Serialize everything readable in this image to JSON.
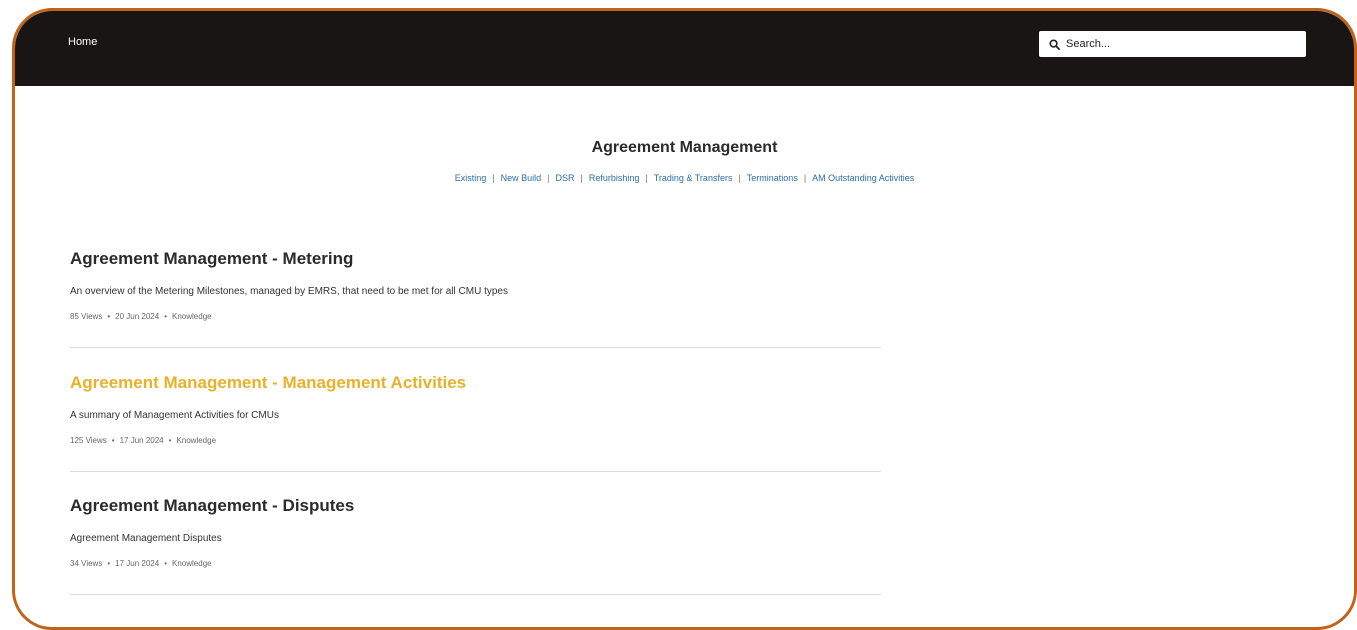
{
  "nav": {
    "home_label": "Home"
  },
  "search": {
    "placeholder": "Search..."
  },
  "page": {
    "title": "Agreement Management",
    "subnav": [
      "Existing",
      "New Build",
      "DSR",
      "Refurbishing",
      "Trading & Transfers",
      "Terminations",
      "AM Outstanding Activities"
    ],
    "subnav_separator": "|"
  },
  "articles": [
    {
      "title": "Agreement Management - Metering",
      "description": "An overview of the Metering Milestones, managed by EMRS, that need to be met for all CMU types",
      "views": "85 Views",
      "date": "20 Jun 2024",
      "type": "Knowledge",
      "highlighted": false
    },
    {
      "title": "Agreement Management - Management Activities",
      "description": "A summary of Management Activities for CMUs",
      "views": "125 Views",
      "date": "17 Jun 2024",
      "type": "Knowledge",
      "highlighted": true
    },
    {
      "title": "Agreement Management - Disputes",
      "description": "Agreement Management Disputes",
      "views": "34 Views",
      "date": "17 Jun 2024",
      "type": "Knowledge",
      "highlighted": false
    }
  ],
  "meta_separator": "•",
  "colors": {
    "header_bg": "#1a1515",
    "frame_border": "#c0641c",
    "link": "#2d6ea8",
    "highlight": "#e8b12a"
  },
  "icons": {
    "search": "search-icon"
  }
}
